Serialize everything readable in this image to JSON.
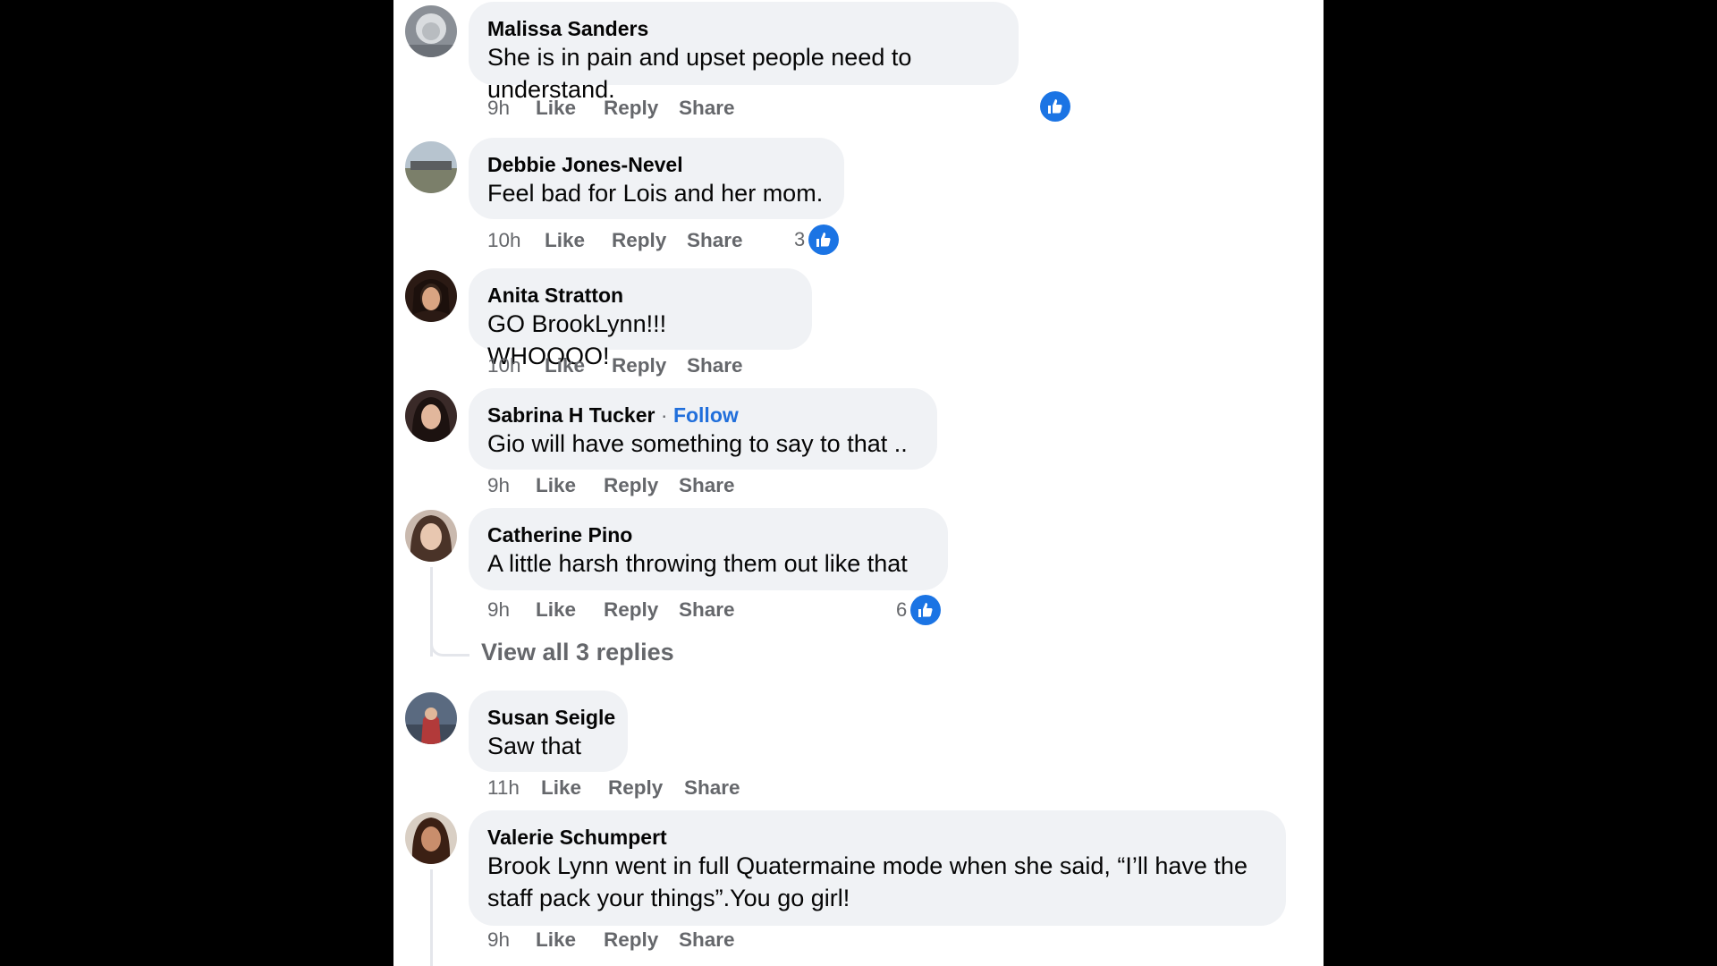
{
  "comments": [
    {
      "author": "Malissa Sanders",
      "text": "She is in pain and upset people need to understand.",
      "time": "9h",
      "like": "Like",
      "reply": "Reply",
      "share": "Share",
      "reaction_count": "",
      "reaction_icon": "like-icon"
    },
    {
      "author": "Debbie Jones-Nevel",
      "text": "Feel bad for Lois and her mom.",
      "time": "10h",
      "like": "Like",
      "reply": "Reply",
      "share": "Share",
      "reaction_count": "3",
      "reaction_icon": "like-icon"
    },
    {
      "author": "Anita Stratton",
      "text": "GO BrookLynn!!! WHOOOO!",
      "time": "10h",
      "like": "Like",
      "reply": "Reply",
      "share": "Share"
    },
    {
      "author": "Sabrina H Tucker",
      "follow_sep": " · ",
      "follow": "Follow",
      "text": "Gio will have something to say to that ..",
      "time": "9h",
      "like": "Like",
      "reply": "Reply",
      "share": "Share"
    },
    {
      "author": "Catherine Pino",
      "text": "A little harsh throwing them out like that",
      "time": "9h",
      "like": "Like",
      "reply": "Reply",
      "share": "Share",
      "reaction_count": "6",
      "reaction_icon": "like-icon",
      "view_replies": "View all 3 replies"
    },
    {
      "author": "Susan Seigle",
      "text": "Saw that",
      "time": "11h",
      "like": "Like",
      "reply": "Reply",
      "share": "Share"
    },
    {
      "author": "Valerie Schumpert",
      "text": "Brook Lynn went in full Quatermaine mode when she said, “I’ll have the staff pack your things”.You go girl!",
      "time": "9h",
      "like": "Like",
      "reply": "Reply",
      "share": "Share"
    }
  ],
  "colors": {
    "background": "#000000",
    "panel": "#ffffff",
    "bubble": "#f0f2f5",
    "link": "#216fdb",
    "like_badge": "#1b74e4",
    "meta": "#65676b"
  }
}
